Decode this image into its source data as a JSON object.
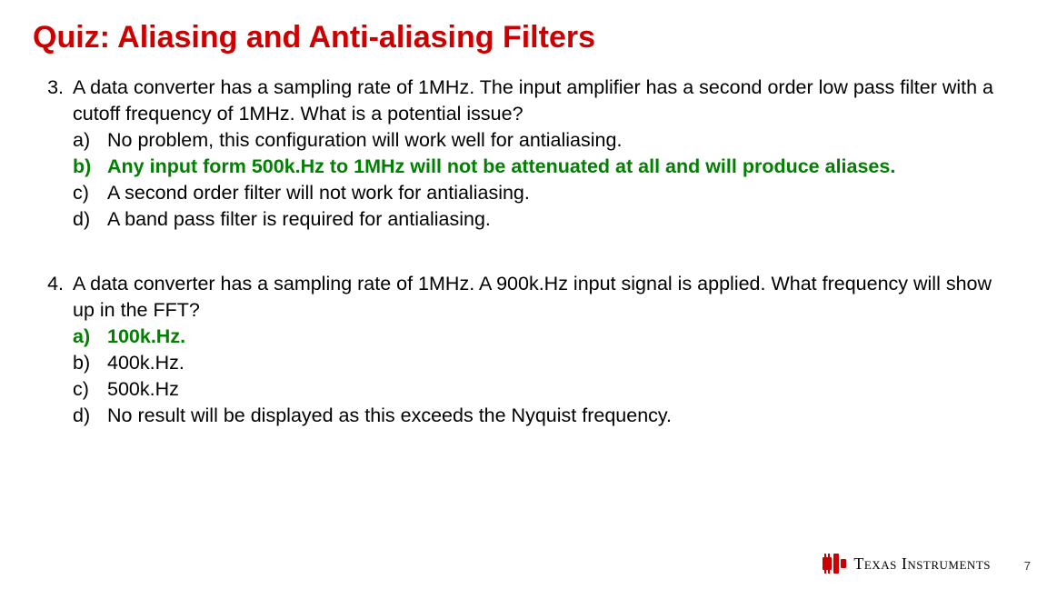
{
  "title": "Quiz: Aliasing and Anti-aliasing Filters",
  "questions": [
    {
      "number": "3.",
      "prompt": "A data converter has a sampling rate of 1MHz.  The input amplifier has a second order low pass filter with a cutoff frequency of 1MHz.  What is a potential issue?",
      "options": [
        {
          "letter": "a)",
          "text": "No problem, this configuration will work well for antialiasing.",
          "correct": false
        },
        {
          "letter": "b)",
          "text": "Any input form 500k.Hz to 1MHz will not be attenuated at all and will produce aliases.",
          "correct": true
        },
        {
          "letter": "c)",
          "text": "A second order filter will not work for antialiasing.",
          "correct": false
        },
        {
          "letter": "d)",
          "text": "A band pass filter is required for antialiasing.",
          "correct": false
        }
      ]
    },
    {
      "number": "4.",
      "prompt": "A data converter has a sampling rate of 1MHz.  A 900k.Hz input signal is applied.  What frequency will show up in the FFT?",
      "options": [
        {
          "letter": "a)",
          "text": "100k.Hz.",
          "correct": true
        },
        {
          "letter": "b)",
          "text": " 400k.Hz.",
          "correct": false
        },
        {
          "letter": "c)",
          "text": " 500k.Hz",
          "correct": false
        },
        {
          "letter": "d)",
          "text": " No result will be displayed as this exceeds the Nyquist frequency.",
          "correct": false
        }
      ]
    }
  ],
  "footer": {
    "brand_first": "T",
    "brand_rest_1": "exas ",
    "brand_second": "I",
    "brand_rest_2": "nstruments",
    "page": "7"
  },
  "colors": {
    "title": "#cc0000",
    "correct": "#008000",
    "logo_chip": "#cc0000"
  }
}
